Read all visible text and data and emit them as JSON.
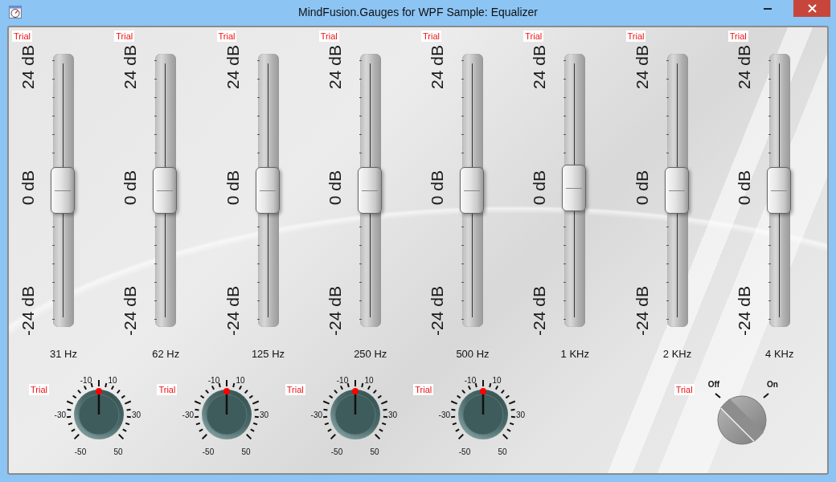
{
  "window": {
    "title": "MindFusion.Gauges for WPF Sample: Equalizer"
  },
  "bands": [
    {
      "trial": "Trial",
      "scale": [
        "24 dB",
        "0 dB",
        "-24 dB"
      ],
      "level": 0.5,
      "label": "31 Hz"
    },
    {
      "trial": "Trial",
      "scale": [
        "24 dB",
        "0 dB",
        "-24 dB"
      ],
      "level": 0.5,
      "label": "62 Hz"
    },
    {
      "trial": "Trial",
      "scale": [
        "24 dB",
        "0 dB",
        "-24 dB"
      ],
      "level": 0.5,
      "label": "125 Hz"
    },
    {
      "trial": "Trial",
      "scale": [
        "24 dB",
        "0 dB",
        "-24 dB"
      ],
      "level": 0.5,
      "label": "250 Hz"
    },
    {
      "trial": "Trial",
      "scale": [
        "24 dB",
        "0 dB",
        "-24 dB"
      ],
      "level": 0.5,
      "label": "500 Hz"
    },
    {
      "trial": "Trial",
      "scale": [
        "24 dB",
        "0 dB",
        "-24 dB"
      ],
      "level": 0.51,
      "label": "1 KHz"
    },
    {
      "trial": "Trial",
      "scale": [
        "24 dB",
        "0 dB",
        "-24 dB"
      ],
      "level": 0.5,
      "label": "2 KHz"
    },
    {
      "trial": "Trial",
      "scale": [
        "24 dB",
        "0 dB",
        "-24 dB"
      ],
      "level": 0.5,
      "label": "4 KHz"
    }
  ],
  "knobs": [
    {
      "trial": "Trial",
      "labels": [
        "-10",
        "10",
        "-30",
        "30",
        "-50",
        "50"
      ]
    },
    {
      "trial": "Trial",
      "labels": [
        "-10",
        "10",
        "-30",
        "30",
        "-50",
        "50"
      ]
    },
    {
      "trial": "Trial",
      "labels": [
        "-10",
        "10",
        "-30",
        "30",
        "-50",
        "50"
      ]
    },
    {
      "trial": "Trial",
      "labels": [
        "-10",
        "10",
        "-30",
        "30",
        "-50",
        "50"
      ]
    }
  ],
  "switch": {
    "trial": "Trial",
    "off_label": "Off",
    "on_label": "On",
    "on": false
  }
}
